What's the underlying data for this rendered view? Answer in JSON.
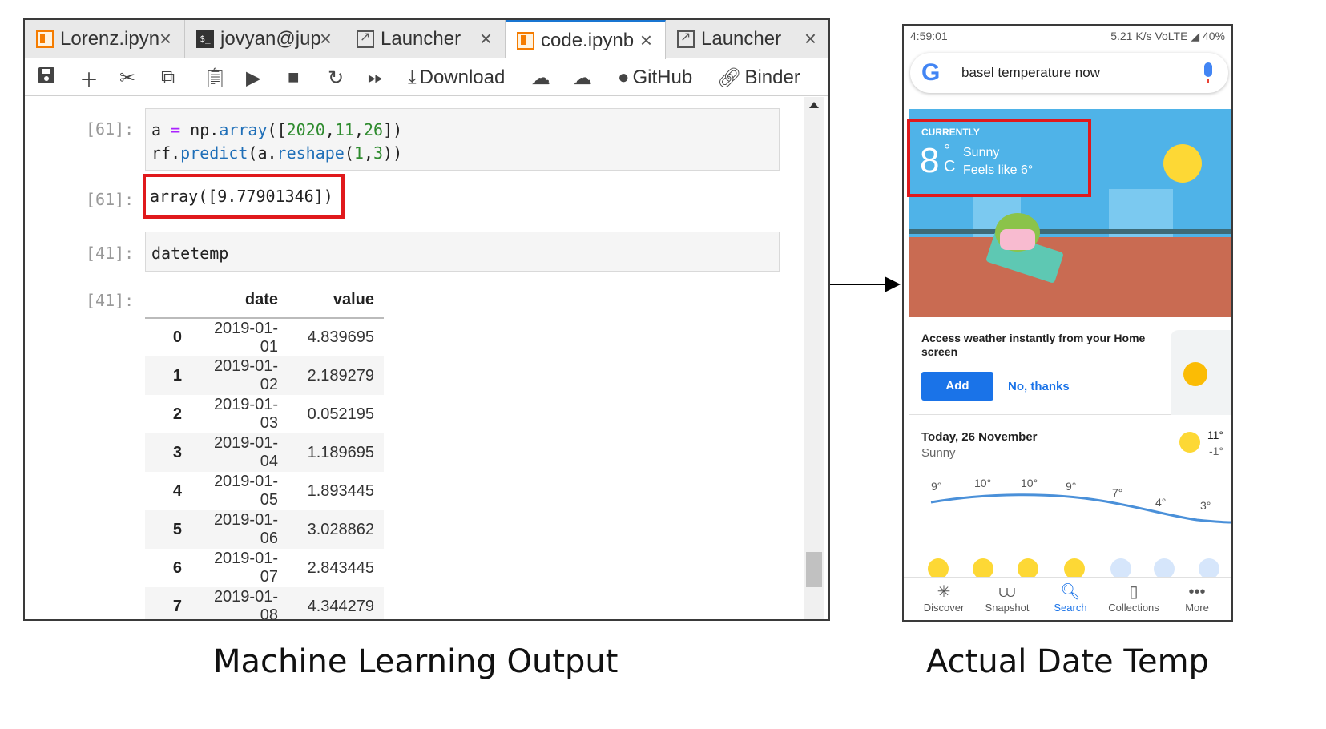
{
  "jupyter": {
    "tabs": [
      {
        "label": "Lorenz.ipyn",
        "icon": "notebook-icon"
      },
      {
        "label": "jovyan@jup",
        "icon": "terminal-icon"
      },
      {
        "label": "Launcher",
        "icon": "launcher-icon"
      },
      {
        "label": "code.ipynb",
        "icon": "notebook-icon",
        "active": true
      },
      {
        "label": "Launcher",
        "icon": "launcher-icon"
      }
    ],
    "toolbar": {
      "download": "Download",
      "github": "GitHub",
      "binder": "Binder"
    },
    "cells": {
      "c1_prompt": "[61]:",
      "c1_out_prompt": "[61]:",
      "c1_output": "array([9.77901346])",
      "c2_prompt": "[41]:",
      "c2_code": "datetemp",
      "c2_out_prompt": "[41]:"
    },
    "table": {
      "headers": [
        "",
        "date",
        "value"
      ],
      "rows": [
        [
          "0",
          "2019-01-01",
          "4.839695"
        ],
        [
          "1",
          "2019-01-02",
          "2.189279"
        ],
        [
          "2",
          "2019-01-03",
          "0.052195"
        ],
        [
          "3",
          "2019-01-04",
          "1.189695"
        ],
        [
          "4",
          "2019-01-05",
          "1.893445"
        ],
        [
          "5",
          "2019-01-06",
          "3.028862"
        ],
        [
          "6",
          "2019-01-07",
          "2.843445"
        ],
        [
          "7",
          "2019-01-08",
          "4.344279"
        ]
      ]
    }
  },
  "phone": {
    "status_time": "4:59:01",
    "status_right": "5.21 K/s  VoLTE  ◢ 40%",
    "search_text": "basel temperature now",
    "weather": {
      "currently": "CURRENTLY",
      "temp": "8",
      "unit": "°\nC",
      "condition": "Sunny",
      "feels_like": "Feels like 6°"
    },
    "card1": {
      "text": "Access weather instantly from your Home screen",
      "add": "Add",
      "no_thanks": "No, thanks"
    },
    "card2": {
      "date": "Today, 26 November",
      "condition": "Sunny",
      "high": "11°",
      "low": "-1°",
      "hourly_temps": [
        "9°",
        "10°",
        "10°",
        "9°",
        "7°",
        "4°",
        "3°"
      ]
    },
    "nav": [
      "Discover",
      "Snapshot",
      "Search",
      "Collections",
      "More"
    ]
  },
  "captions": {
    "left": "Machine Learning Output",
    "right": "Actual Date Temp"
  },
  "colors": {
    "highlight_red": "#e0191c",
    "google_blue": "#1a73e8",
    "weather_sky": "#4fb3e8"
  }
}
